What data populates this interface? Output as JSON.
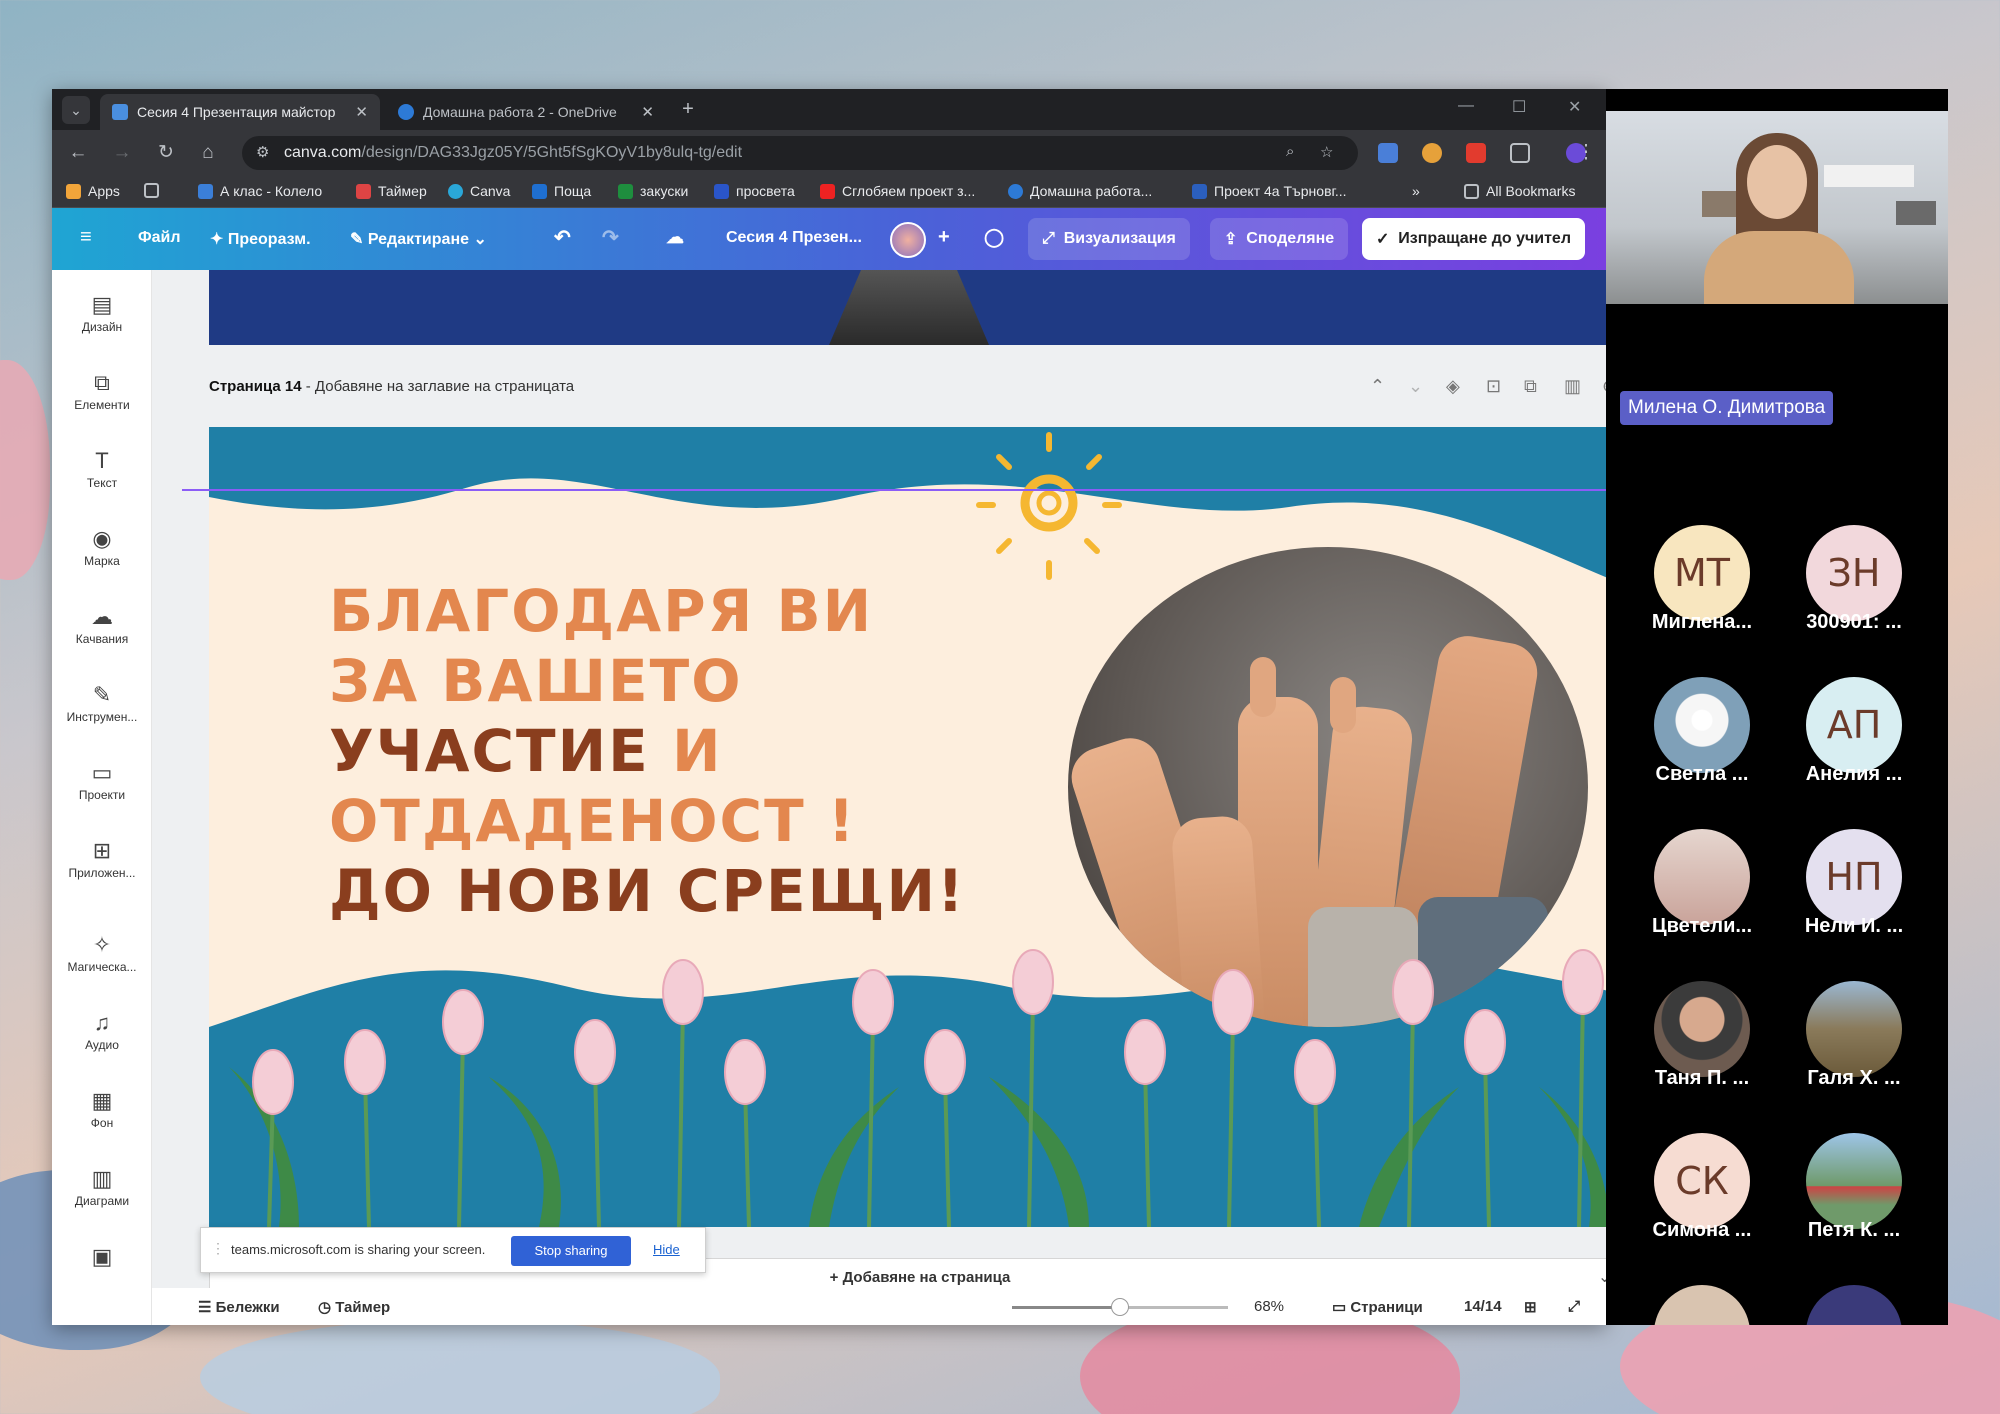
{
  "browser": {
    "tabs": [
      {
        "label": "Сесия 4 Презентация майстор",
        "active": true
      },
      {
        "label": "Домашна работа 2 - OneDrive",
        "active": false
      }
    ],
    "url_host": "canva.com",
    "url_path": "/design/DAG33Jgz05Y/5Ght5fSgKOyV1by8ulq-tg/edit",
    "bookmarks": [
      "Apps",
      "А клас - Колело",
      "Таймер",
      "Canva",
      "Поща",
      "закуски",
      "просвета",
      "Сглобяем проект з...",
      "Домашна работа...",
      "Проект 4а Търновг..."
    ],
    "all_bookmarks": "All Bookmarks"
  },
  "canva": {
    "menu": {
      "file": "Файл",
      "resize": "Преоразм.",
      "editing": "Редактиране",
      "title": "Сесия 4 Презен...",
      "present": "Визуализация",
      "share": "Споделяне",
      "send": "Изпращане до учител"
    },
    "rail": [
      "Дизайн",
      "Елементи",
      "Текст",
      "Марка",
      "Качвания",
      "Инструмен...",
      "Проекти",
      "Приложен...",
      "Магическа...",
      "Аудио",
      "Фон",
      "Диаграми"
    ],
    "page_label_strong": "Страница 14",
    "page_label_rest": " - Добавяне на заглавие на страницата",
    "slide": {
      "line1": "БЛАГОДАРЯ ВИ",
      "line2": "ЗА ВАШЕТО",
      "line3a": "УЧАСТИЕ",
      "line3b": " И",
      "line4": "ОТДАДЕНОСТ !",
      "line5": "ДО НОВИ СРЕЩИ!"
    },
    "add_page": "+ Добавяне на страница",
    "bottom": {
      "notes": "Бележки",
      "timer": "Таймер",
      "zoom": "68%",
      "pages": "Страници",
      "page_count": "14/14"
    },
    "zoom_level": 0.5
  },
  "sharebar": {
    "text": "teams.microsoft.com is sharing your screen.",
    "stop": "Stop sharing",
    "hide": "Hide"
  },
  "teams": {
    "presenter": "Милена О. Димитрова",
    "participants": [
      {
        "initials": "МТ",
        "name": "Мигле­на...",
        "color": "#f8e6bf"
      },
      {
        "initials": "ЗН",
        "name": "300901: ...",
        "color": "#f2d8dc"
      },
      {
        "initials": "",
        "name": "Светла ...",
        "color": "#7fa0b8"
      },
      {
        "initials": "АП",
        "name": "Анелия ...",
        "color": "#d8eef2"
      },
      {
        "initials": "",
        "name": "Цветели...",
        "color": "#c9a39a"
      },
      {
        "initials": "НП",
        "name": "Нели И. ...",
        "color": "#e4e0ef"
      },
      {
        "initials": "",
        "name": "Таня П. ...",
        "color": "#6d5b50"
      },
      {
        "initials": "",
        "name": "Галя Х. ...",
        "color": "#8a7a5a"
      },
      {
        "initials": "СК",
        "name": "Симона ...",
        "color": "#f6dcd2"
      },
      {
        "initials": "",
        "name": "Петя К. ...",
        "color": "#6f9a6a"
      }
    ]
  },
  "colors": {
    "orange": "#e3874e",
    "brown": "#8a3e1e",
    "teal": "#1f7fa6",
    "canva_start": "#1fa5d3",
    "canva_end": "#7a3fe0",
    "teams_name": "#5b5fc7"
  }
}
